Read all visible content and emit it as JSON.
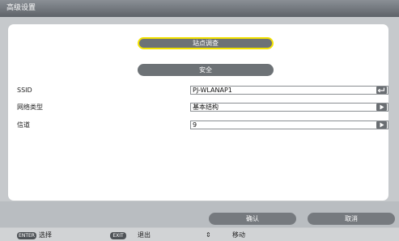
{
  "window": {
    "title": "高级设置"
  },
  "tabs": [
    {
      "label": "站点调查",
      "selected": true
    },
    {
      "label": "安全",
      "selected": false
    }
  ],
  "fields": [
    {
      "label": "SSID",
      "value": "PJ-WLANAP1",
      "button_icon": "return-arrow-icon"
    },
    {
      "label": "网络类型",
      "value": "基本结构",
      "button_icon": "play-triangle-icon"
    },
    {
      "label": "信道",
      "value": "9",
      "button_icon": "play-triangle-icon"
    }
  ],
  "actions": {
    "ok_label": "确认",
    "cancel_label": "取消"
  },
  "footer": {
    "enter_key": "ENTER",
    "enter_label": "选择",
    "exit_key": "EXIT",
    "exit_label": "退出",
    "move_symbol": "⇕",
    "move_label": "移动"
  },
  "colors": {
    "accent": "#f3e200",
    "pill": "#6d7276",
    "background": "#c6c9cc"
  }
}
